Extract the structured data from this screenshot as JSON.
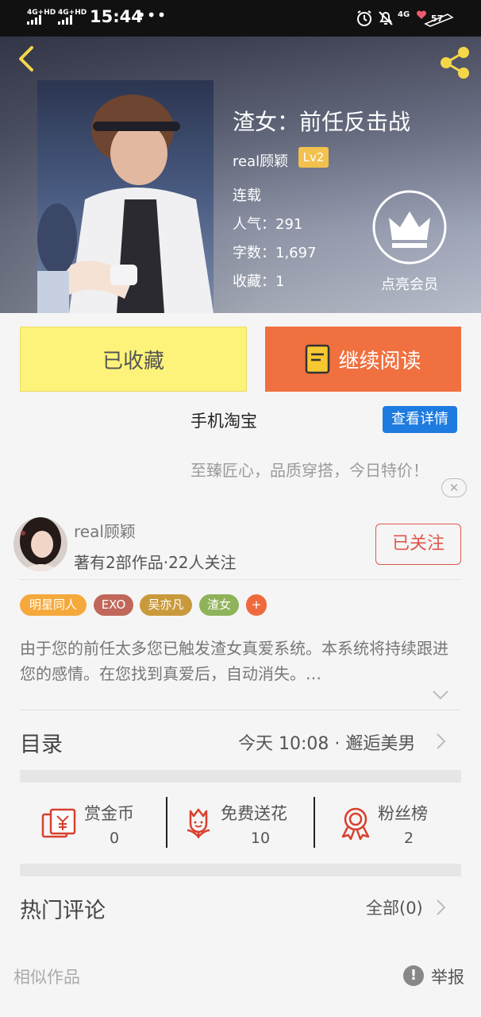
{
  "status_bar": {
    "signal_1": "4G+HD",
    "signal_2": "4G+HD",
    "time": "15:44",
    "more_dots": "•••",
    "net": "4G",
    "battery": "57"
  },
  "book": {
    "title": "渣女：前任反击战",
    "author": "real顾颖",
    "author_level": "Lv2",
    "status": "连载",
    "popularity": "人气：291",
    "word_count": "字数：1,697",
    "favorites": "收藏：1",
    "vip_label": "点亮会员"
  },
  "actions": {
    "favorited_label": "已收藏",
    "continue_label": "继续阅读"
  },
  "ad": {
    "title": "手机淘宝",
    "button": "查看详情",
    "description": "至臻匠心，品质穿搭，今日特价！",
    "close": "✕"
  },
  "author_block": {
    "name": "real顾颖",
    "stats": "著有2部作品·22人关注",
    "follow_label": "已关注"
  },
  "tags": [
    {
      "label": "明星同人",
      "color": "#f5a93a"
    },
    {
      "label": "EXO",
      "color": "#c0675a"
    },
    {
      "label": "吴亦凡",
      "color": "#c99a3c"
    },
    {
      "label": "渣女",
      "color": "#8fb35a"
    },
    {
      "label": "+",
      "color": "#ee6a3e"
    }
  ],
  "description": "由于您的前任太多您已触发渣女真爱系统。本系统将持续跟进您的感情。在您找到真爱后，自动消失。…",
  "toc": {
    "label": "目录",
    "latest": "今天 10:08 · 邂逅美男"
  },
  "stats": [
    {
      "label": "赏金币",
      "value": "0"
    },
    {
      "label": "免费送花",
      "value": "10"
    },
    {
      "label": "粉丝榜",
      "value": "2"
    }
  ],
  "comments": {
    "label": "热门评论",
    "all_label": "全部(0)"
  },
  "similar": {
    "label": "相似作品",
    "report_label": "举报",
    "report_icon": "!"
  },
  "colors": {
    "accent_orange": "#f0703f",
    "favorite_yellow": "#fdf37a",
    "follow_red": "#e2574c",
    "ad_blue": "#1e7be0",
    "icon_red": "#d8402e"
  }
}
